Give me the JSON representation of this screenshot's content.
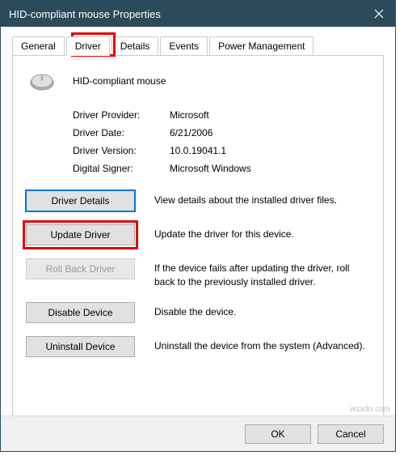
{
  "titlebar": {
    "title": "HID-compliant mouse Properties"
  },
  "tabs": {
    "general": "General",
    "driver": "Driver",
    "details": "Details",
    "events": "Events",
    "power": "Power Management"
  },
  "device": {
    "name": "HID-compliant mouse"
  },
  "info": {
    "provider_label": "Driver Provider:",
    "provider_value": "Microsoft",
    "date_label": "Driver Date:",
    "date_value": "6/21/2006",
    "version_label": "Driver Version:",
    "version_value": "10.0.19041.1",
    "signer_label": "Digital Signer:",
    "signer_value": "Microsoft Windows"
  },
  "buttons": {
    "details": {
      "label": "Driver Details",
      "desc": "View details about the installed driver files."
    },
    "update": {
      "label": "Update Driver",
      "desc": "Update the driver for this device."
    },
    "rollback": {
      "label": "Roll Back Driver",
      "desc": "If the device fails after updating the driver, roll back to the previously installed driver."
    },
    "disable": {
      "label": "Disable Device",
      "desc": "Disable the device."
    },
    "uninstall": {
      "label": "Uninstall Device",
      "desc": "Uninstall the device from the system (Advanced)."
    }
  },
  "footer": {
    "ok": "OK",
    "cancel": "Cancel"
  },
  "watermark": "wsxdn.com"
}
